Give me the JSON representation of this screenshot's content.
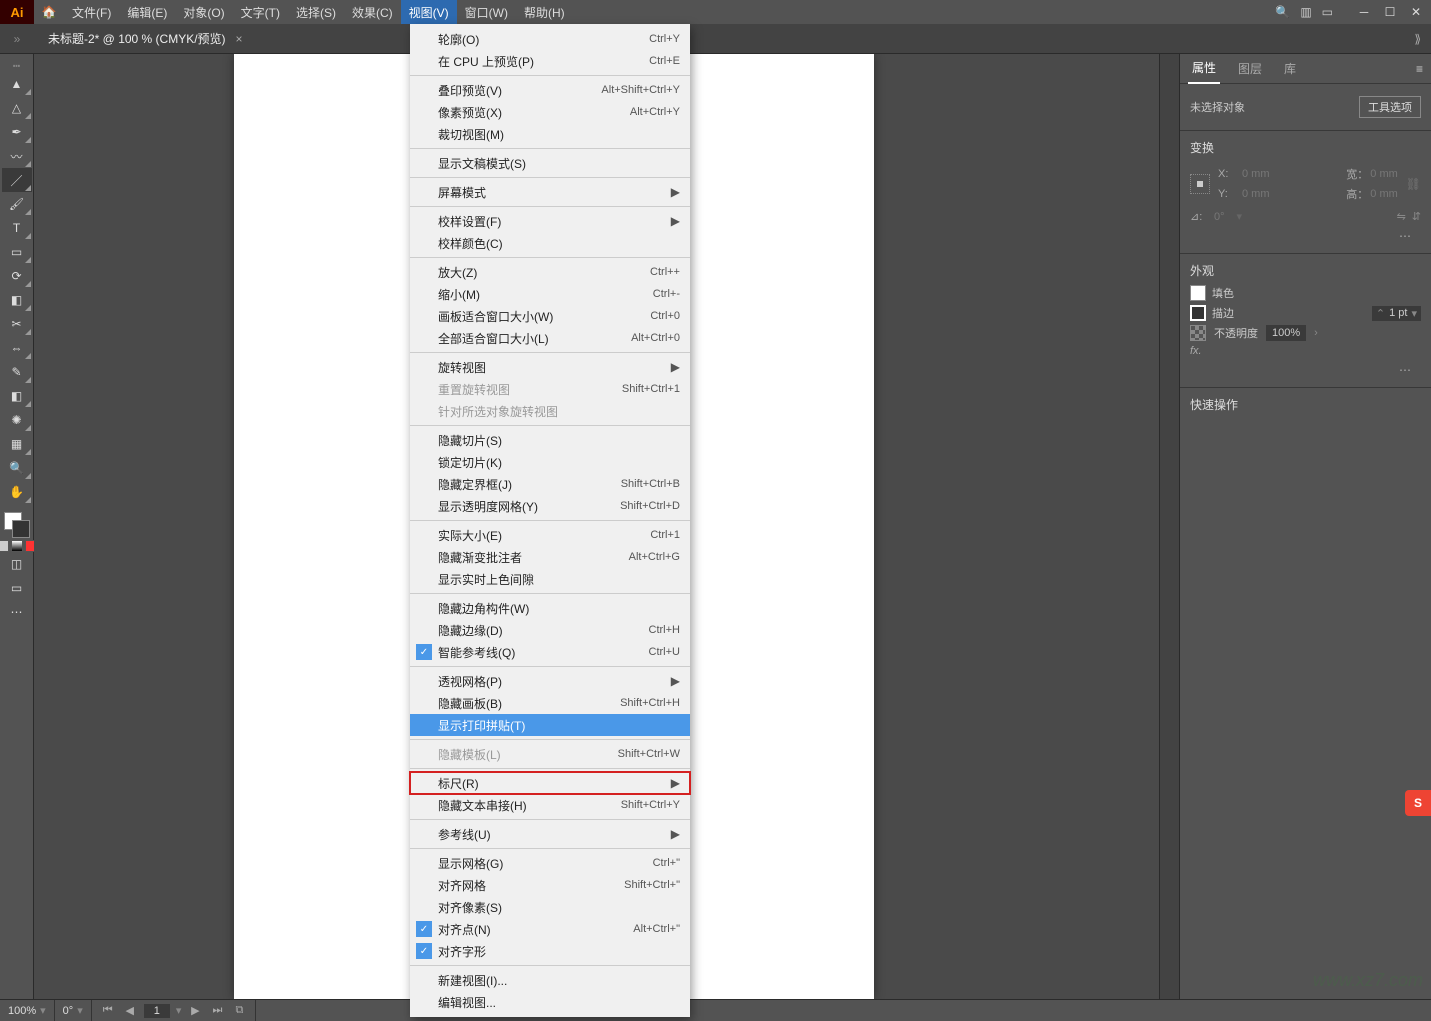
{
  "app": {
    "logo_text": "Ai"
  },
  "menubar": {
    "items": [
      {
        "label": "文件(F)"
      },
      {
        "label": "编辑(E)"
      },
      {
        "label": "对象(O)"
      },
      {
        "label": "文字(T)"
      },
      {
        "label": "选择(S)"
      },
      {
        "label": "效果(C)"
      },
      {
        "label": "视图(V)",
        "active": true
      },
      {
        "label": "窗口(W)"
      },
      {
        "label": "帮助(H)"
      }
    ]
  },
  "doc_tab": {
    "title": "未标题-2* @ 100 % (CMYK/预览)"
  },
  "view_menu": {
    "groups": [
      [
        {
          "label": "轮廓(O)",
          "shortcut": "Ctrl+Y"
        },
        {
          "label": "在 CPU 上预览(P)",
          "shortcut": "Ctrl+E"
        }
      ],
      [
        {
          "label": "叠印预览(V)",
          "shortcut": "Alt+Shift+Ctrl+Y"
        },
        {
          "label": "像素预览(X)",
          "shortcut": "Alt+Ctrl+Y"
        },
        {
          "label": "裁切视图(M)"
        }
      ],
      [
        {
          "label": "显示文稿模式(S)"
        }
      ],
      [
        {
          "label": "屏幕模式",
          "submenu": true
        }
      ],
      [
        {
          "label": "校样设置(F)",
          "submenu": true
        },
        {
          "label": "校样颜色(C)"
        }
      ],
      [
        {
          "label": "放大(Z)",
          "shortcut": "Ctrl++"
        },
        {
          "label": "缩小(M)",
          "shortcut": "Ctrl+-"
        },
        {
          "label": "画板适合窗口大小(W)",
          "shortcut": "Ctrl+0"
        },
        {
          "label": "全部适合窗口大小(L)",
          "shortcut": "Alt+Ctrl+0"
        }
      ],
      [
        {
          "label": "旋转视图",
          "submenu": true
        },
        {
          "label": "重置旋转视图",
          "shortcut": "Shift+Ctrl+1",
          "disabled": true
        },
        {
          "label": "针对所选对象旋转视图",
          "disabled": true
        }
      ],
      [
        {
          "label": "隐藏切片(S)"
        },
        {
          "label": "锁定切片(K)"
        },
        {
          "label": "隐藏定界框(J)",
          "shortcut": "Shift+Ctrl+B"
        },
        {
          "label": "显示透明度网格(Y)",
          "shortcut": "Shift+Ctrl+D"
        }
      ],
      [
        {
          "label": "实际大小(E)",
          "shortcut": "Ctrl+1"
        },
        {
          "label": "隐藏渐变批注者",
          "shortcut": "Alt+Ctrl+G"
        },
        {
          "label": "显示实时上色间隙"
        }
      ],
      [
        {
          "label": "隐藏边角构件(W)"
        },
        {
          "label": "隐藏边缘(D)",
          "shortcut": "Ctrl+H"
        },
        {
          "label": "智能参考线(Q)",
          "shortcut": "Ctrl+U",
          "checked": true
        }
      ],
      [
        {
          "label": "透视网格(P)",
          "submenu": true
        },
        {
          "label": "隐藏画板(B)",
          "shortcut": "Shift+Ctrl+H"
        },
        {
          "label": "显示打印拼贴(T)",
          "highlight": true
        }
      ],
      [
        {
          "label": "隐藏模板(L)",
          "shortcut": "Shift+Ctrl+W",
          "disabled": true
        }
      ],
      [
        {
          "label": "标尺(R)",
          "submenu": true,
          "redbox": true
        },
        {
          "label": "隐藏文本串接(H)",
          "shortcut": "Shift+Ctrl+Y"
        }
      ],
      [
        {
          "label": "参考线(U)",
          "submenu": true
        }
      ],
      [
        {
          "label": "显示网格(G)",
          "shortcut": "Ctrl+\""
        },
        {
          "label": "对齐网格",
          "shortcut": "Shift+Ctrl+\""
        },
        {
          "label": "对齐像素(S)"
        },
        {
          "label": "对齐点(N)",
          "shortcut": "Alt+Ctrl+\"",
          "checked": true
        },
        {
          "label": "对齐字形",
          "checked": true
        }
      ],
      [
        {
          "label": "新建视图(I)..."
        },
        {
          "label": "编辑视图..."
        }
      ]
    ]
  },
  "right_panel": {
    "tabs": [
      {
        "label": "属性",
        "active": true
      },
      {
        "label": "图层"
      },
      {
        "label": "库"
      }
    ],
    "no_selection": "未选择对象",
    "tool_options_btn": "工具选项",
    "transform": {
      "title": "变换",
      "x_label": "X:",
      "x_val": "0 mm",
      "y_label": "Y:",
      "y_val": "0 mm",
      "w_label": "宽：",
      "w_val": "0 mm",
      "h_label": "高：",
      "h_val": "0 mm",
      "angle_label": "⊿:",
      "angle_val": "0°"
    },
    "appearance": {
      "title": "外观",
      "fill_label": "填色",
      "stroke_label": "描边",
      "stroke_val": "1 pt",
      "opacity_label": "不透明度",
      "opacity_val": "100%",
      "fx_label": "fx."
    },
    "quick_actions": {
      "title": "快速操作"
    }
  },
  "statusbar": {
    "zoom": "100%",
    "rotation": "0°",
    "artboard_page": "1"
  },
  "tools": [
    "selection",
    "direct-selection",
    "pen",
    "curvature",
    "line",
    "brush",
    "type",
    "rectangle",
    "rotate",
    "eraser",
    "scissors",
    "width",
    "eyedropper",
    "gradient",
    "symbol-sprayer",
    "artboard",
    "zoom",
    "hand"
  ],
  "side_badge": "S"
}
